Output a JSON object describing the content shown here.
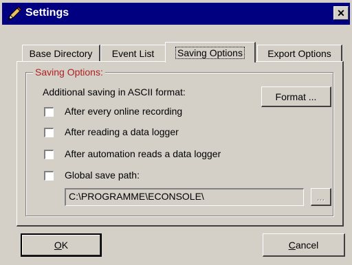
{
  "window": {
    "title": "Settings",
    "close_glyph": "✕",
    "icon": "pencil-icon"
  },
  "tabs": [
    {
      "label": "Base Directory",
      "active": false
    },
    {
      "label": "Event List",
      "active": false
    },
    {
      "label": "Saving Options",
      "active": true
    },
    {
      "label": "Export Options",
      "active": false
    }
  ],
  "group": {
    "legend": "Saving Options:",
    "ascii_label": "Additional saving in ASCII format:",
    "format_button": "Format ...",
    "options": [
      {
        "label": "After every online recording",
        "checked": false
      },
      {
        "label": "After reading a data logger",
        "checked": false
      },
      {
        "label": "After automation reads a data logger",
        "checked": false
      },
      {
        "label": "Global save path:",
        "checked": false
      }
    ],
    "save_path": "C:\\PROGRAMME\\ECONSOLE\\",
    "browse_button": "..."
  },
  "buttons": {
    "ok": "OK",
    "cancel": "Cancel"
  },
  "colors": {
    "titlebar": "#000080",
    "face": "#d4d0c8",
    "legend": "#b02020"
  }
}
